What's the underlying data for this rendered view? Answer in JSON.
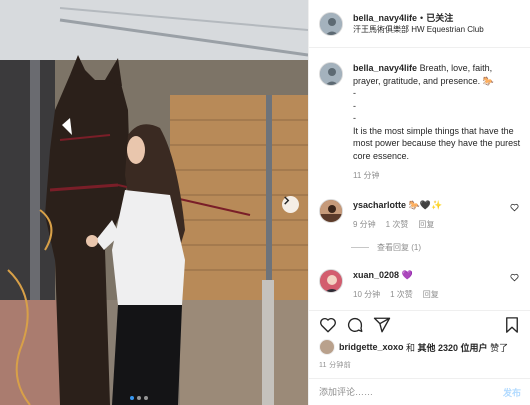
{
  "header": {
    "username": "bella_navy4life",
    "separator": "•",
    "follow_label": "已关注",
    "location": "汗王馬術俱樂部 HW Equestrian Club"
  },
  "caption": {
    "username": "bella_navy4life",
    "text_lines": "Breath, love, faith, prayer, gratitude, and presence. 🐎\n-\n-\n-\nIt is the most simple things that have the most power because they have the purest core essence.",
    "time": "11 分钟"
  },
  "comments": [
    {
      "username": "ysacharlotte",
      "text": "🐎🖤✨",
      "time": "9 分钟",
      "likes": "1 次赞",
      "reply": "回复"
    },
    {
      "username": "xuan_0208",
      "text": "💜",
      "time": "10 分钟",
      "likes": "1 次赞",
      "reply": "回复"
    }
  ],
  "view_replies": "查看回复 (1)",
  "likes": {
    "first_user": "bridgette_xoxo",
    "mid": " 和 ",
    "others": "其他 2320 位用户",
    "end": " 赞了"
  },
  "post_time": "11 分钟前",
  "add_comment": {
    "placeholder": "添加评论……",
    "post_label": "发布"
  },
  "carousel": {
    "current": 1,
    "total": 3
  },
  "colors": {
    "accent": "#3897f0",
    "muted": "#8e8e8e",
    "text": "#262626",
    "border": "#efefef"
  },
  "icons": [
    "chevron-right-icon",
    "heart-icon",
    "comment-icon",
    "share-icon",
    "bookmark-icon"
  ]
}
